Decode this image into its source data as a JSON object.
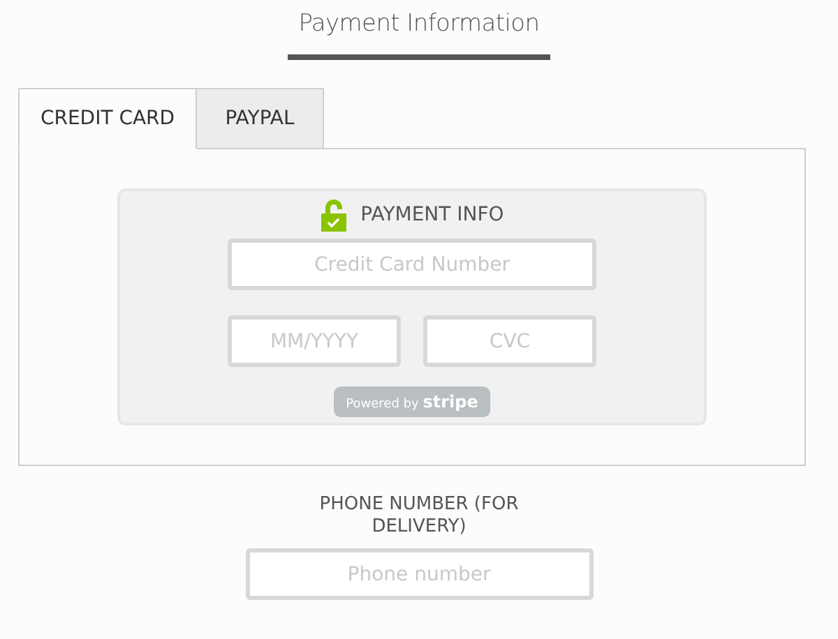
{
  "title": "Payment Information",
  "tabs": [
    {
      "label": "CREDIT CARD",
      "selected": true
    },
    {
      "label": "PAYPAL",
      "selected": false
    }
  ],
  "card_form": {
    "heading": "PAYMENT INFO",
    "fields": [
      {
        "placeholder": "Credit Card Number"
      },
      {
        "placeholder": "MM/YYYY"
      },
      {
        "placeholder": "CVC"
      }
    ],
    "badge": "Powered by **stripe**"
  },
  "phone": {
    "label": "PHONE NUMBER (FOR DELIVERY)",
    "placeholder": "Phone number"
  }
}
